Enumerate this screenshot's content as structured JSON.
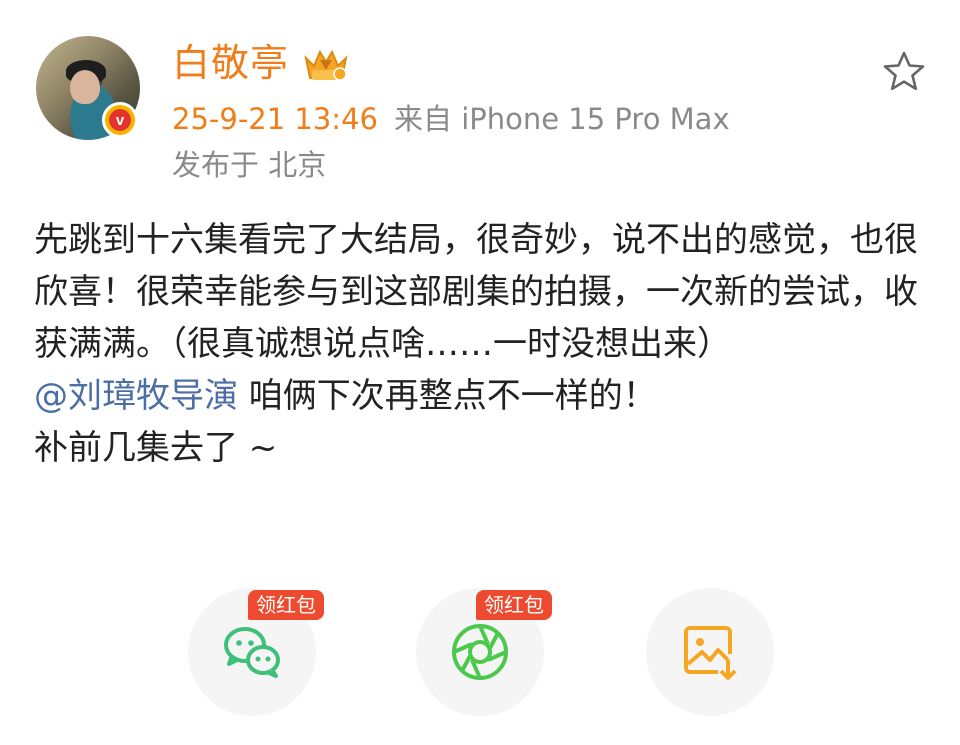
{
  "post": {
    "author": {
      "name": "白敬亭",
      "verified": true,
      "verified_icon": "v-verified-icon",
      "member_icon": "crown-member-icon"
    },
    "time": "25-9-21 13:46",
    "source": "来自 iPhone 15 Pro Max",
    "location": "发布于 北京",
    "content": {
      "line1": "先跳到十六集看完了大结局，很奇妙，说不出的感觉，也很欣喜！很荣幸能参与到这部剧集的拍摄，一次新的尝试，收获满满。（很真诚想说点啥……一时没想出来）",
      "mention": "@刘璋牧导演",
      "line2_rest": " 咱俩下次再整点不一样的！",
      "line3": "补前几集去了 ~"
    },
    "favorite_icon": "star-outline-icon"
  },
  "share": {
    "red_packet_label": "领红包",
    "items": [
      {
        "icon": "wechat-icon",
        "badge": "领红包",
        "color": "#3fc07a"
      },
      {
        "icon": "moments-icon",
        "badge": "领红包",
        "color": "#4cc94c"
      },
      {
        "icon": "save-image-icon",
        "badge": "",
        "color": "#f5a623"
      }
    ]
  },
  "colors": {
    "accent": "#f07d1a",
    "mention": "#4b6ea5",
    "meta_gray": "#8a8a8a",
    "red_badge": "#ee4a2f"
  }
}
